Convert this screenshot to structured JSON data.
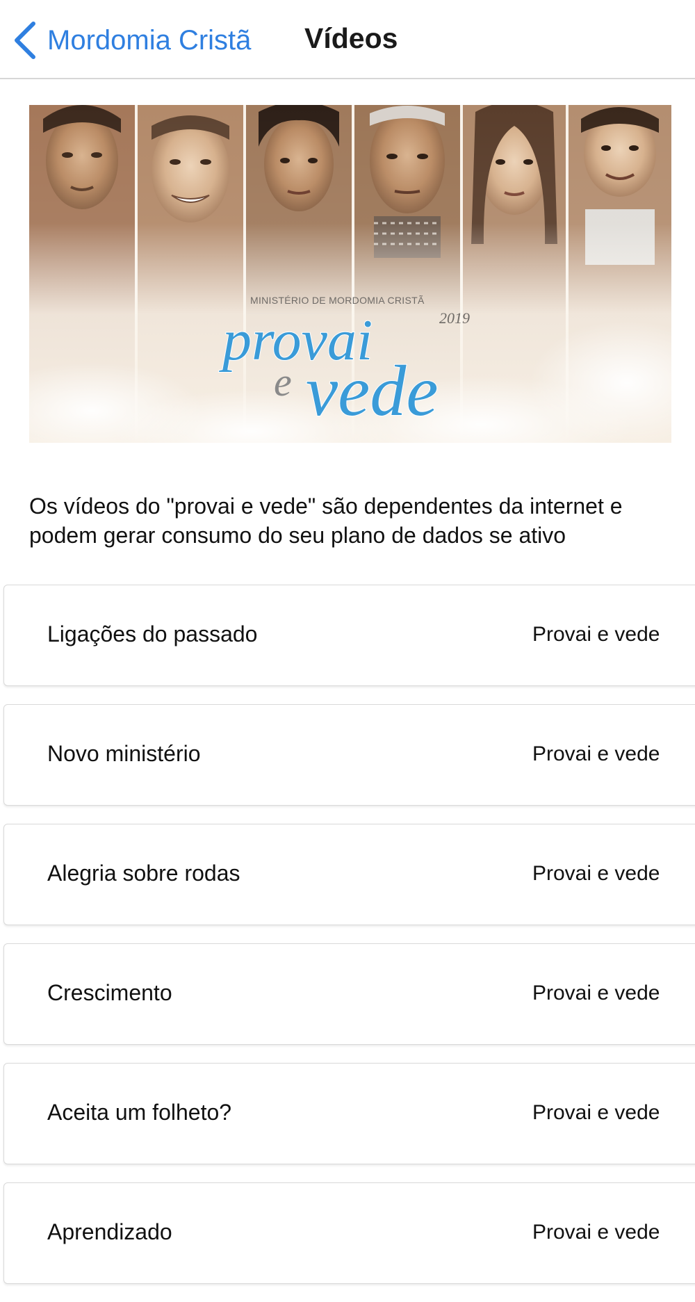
{
  "nav": {
    "back_label": "Mordomia Cristã",
    "title": "Vídeos"
  },
  "banner": {
    "ministry": "MINISTÉRIO DE MORDOMIA CRISTÃ",
    "year": "2019",
    "word1": "provai",
    "word2": "e",
    "word3": "vede"
  },
  "notice": "Os vídeos do \"provai e vede\" são dependentes da internet e podem gerar consumo do seu plano de dados se ativo",
  "videos": [
    {
      "title": "Ligações do passado",
      "series": "Provai e vede"
    },
    {
      "title": "Novo ministério",
      "series": "Provai e vede"
    },
    {
      "title": "Alegria sobre rodas",
      "series": "Provai e vede"
    },
    {
      "title": "Crescimento",
      "series": "Provai e vede"
    },
    {
      "title": "Aceita um folheto?",
      "series": "Provai e vede"
    },
    {
      "title": "Aprendizado",
      "series": "Provai e vede"
    }
  ],
  "colors": {
    "accent": "#2f7fe0",
    "logo_blue": "#3a9bd8",
    "logo_gray": "#8a8a8a"
  },
  "icons": {
    "back": "chevron-left-icon"
  }
}
